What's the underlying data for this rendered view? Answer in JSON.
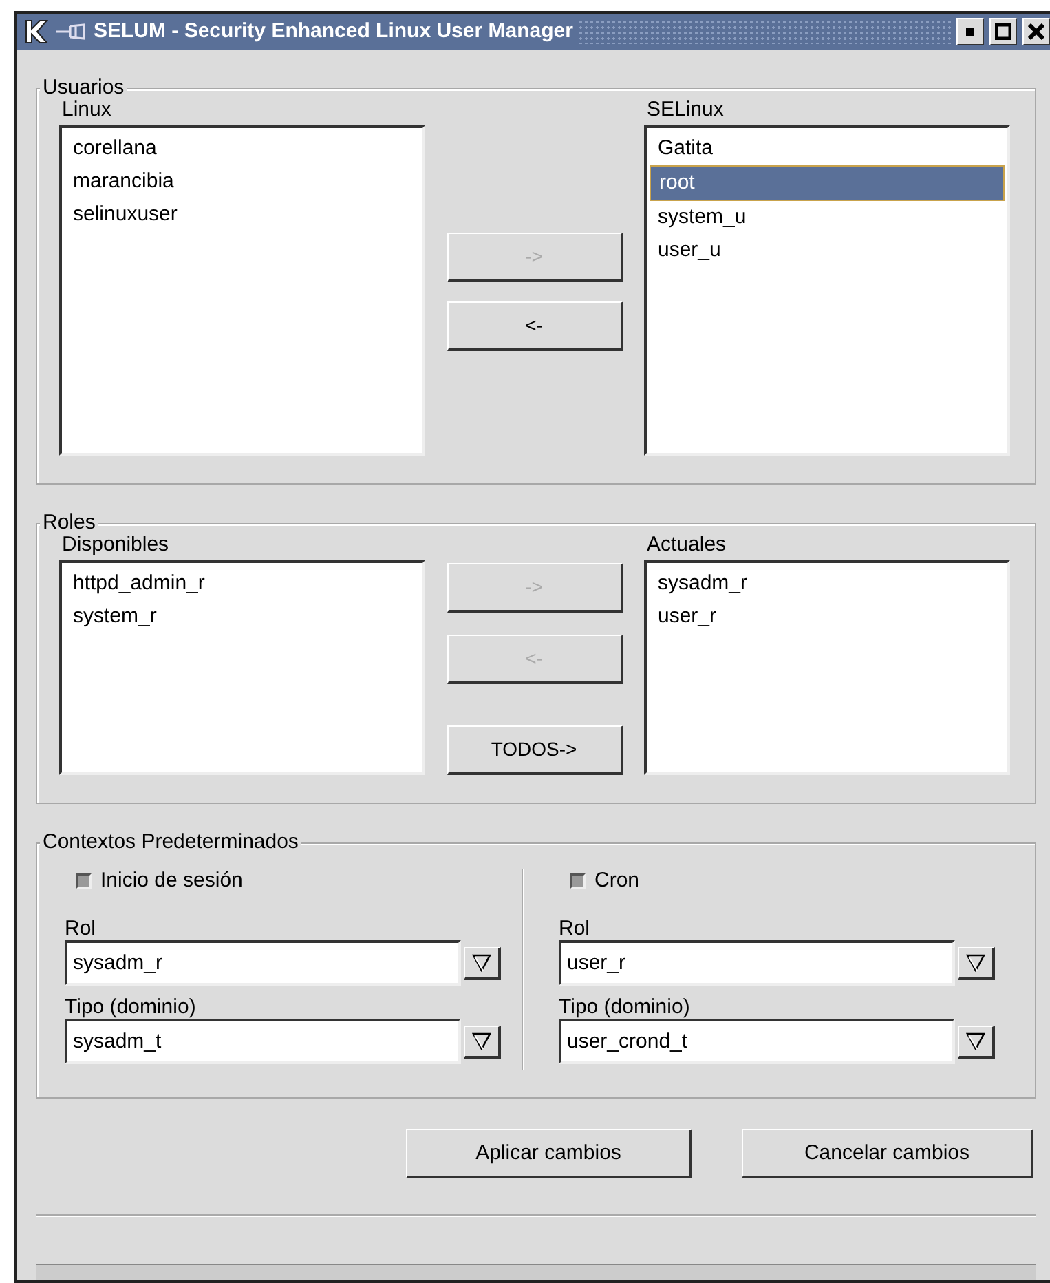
{
  "window": {
    "title": "SELUM - Security Enhanced Linux User Manager"
  },
  "groups": [
    {
      "title": "Usuarios",
      "kind": "transfer",
      "left": {
        "label": "Linux",
        "items": [
          {
            "text": "corellana",
            "selected": false
          },
          {
            "text": "marancibia",
            "selected": false
          },
          {
            "text": "selinuxuser",
            "selected": false
          }
        ]
      },
      "buttons": [
        {
          "label": "->",
          "disabled": true
        },
        {
          "label": "<-",
          "disabled": false
        }
      ],
      "right": {
        "label": "SELinux",
        "items": [
          {
            "text": "Gatita",
            "selected": false
          },
          {
            "text": "root",
            "selected": true
          },
          {
            "text": "system_u",
            "selected": false
          },
          {
            "text": "user_u",
            "selected": false
          }
        ]
      }
    },
    {
      "title": "Roles",
      "kind": "transfer",
      "left": {
        "label": "Disponibles",
        "items": [
          {
            "text": "httpd_admin_r",
            "selected": false
          },
          {
            "text": "system_r",
            "selected": false
          }
        ]
      },
      "buttons": [
        {
          "label": "->",
          "disabled": true
        },
        {
          "label": "<-",
          "disabled": true
        },
        {
          "label": "TODOS->",
          "disabled": false
        }
      ],
      "right": {
        "label": "Actuales",
        "items": [
          {
            "text": "sysadm_r",
            "selected": false
          },
          {
            "text": "user_r",
            "selected": false
          }
        ]
      }
    },
    {
      "title": "Contextos Predeterminados",
      "kind": "contexts",
      "columns": [
        {
          "checkbox": {
            "label": "Inicio de sesión",
            "checked": false
          },
          "combos": [
            {
              "label": "Rol",
              "value": "sysadm_r"
            },
            {
              "label": "Tipo (dominio)",
              "value": "sysadm_t"
            }
          ]
        },
        {
          "checkbox": {
            "label": "Cron",
            "checked": false
          },
          "combos": [
            {
              "label": "Rol",
              "value": "user_r"
            },
            {
              "label": "Tipo (dominio)",
              "value": "user_crond_t"
            }
          ]
        }
      ]
    }
  ],
  "actions": [
    {
      "label": "Aplicar cambios"
    },
    {
      "label": "Cancelar cambios"
    }
  ]
}
